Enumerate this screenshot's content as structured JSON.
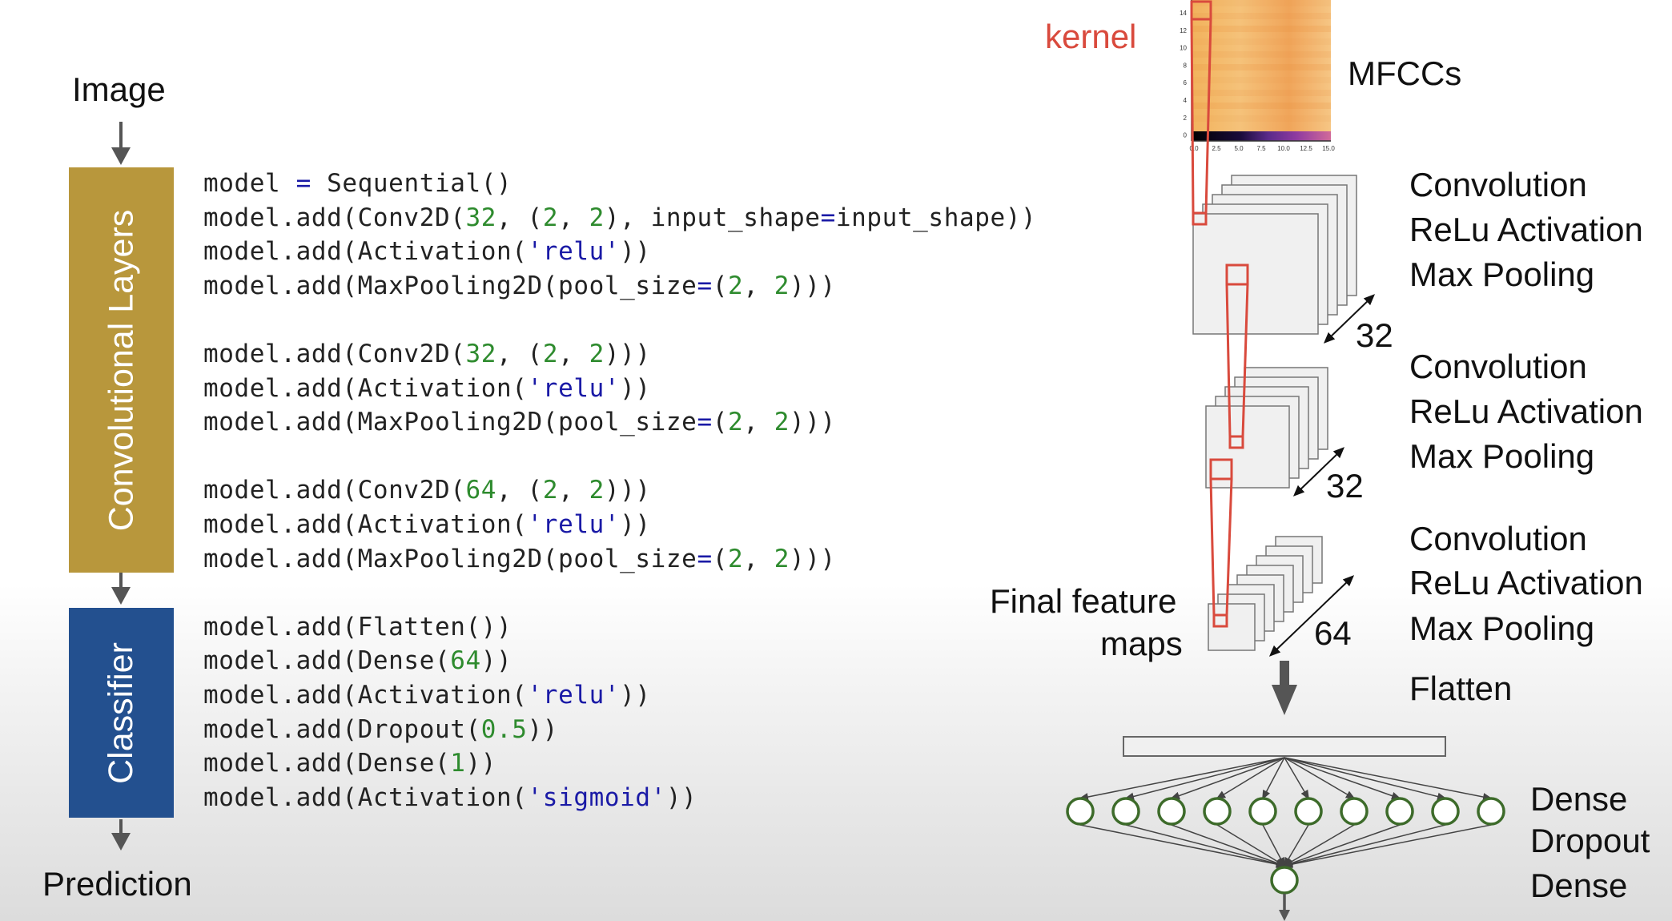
{
  "flow": {
    "input_label": "Image",
    "conv_block_label": "Convolutional Layers",
    "classifier_block_label": "Classifier",
    "output_label": "Prediction"
  },
  "code_lines": [
    [
      {
        "t": "model "
      },
      {
        "t": "=",
        "c": "op"
      },
      {
        "t": " Sequential()"
      }
    ],
    [
      {
        "t": "model.add(Conv2D("
      },
      {
        "t": "32",
        "c": "num"
      },
      {
        "t": ", ("
      },
      {
        "t": "2",
        "c": "num"
      },
      {
        "t": ", "
      },
      {
        "t": "2",
        "c": "num"
      },
      {
        "t": "), input_shape"
      },
      {
        "t": "=",
        "c": "op"
      },
      {
        "t": "input_shape))"
      }
    ],
    [
      {
        "t": "model.add(Activation("
      },
      {
        "t": "'relu'",
        "c": "str"
      },
      {
        "t": "))"
      }
    ],
    [
      {
        "t": "model.add(MaxPooling2D(pool_size"
      },
      {
        "t": "=",
        "c": "op"
      },
      {
        "t": "("
      },
      {
        "t": "2",
        "c": "num"
      },
      {
        "t": ", "
      },
      {
        "t": "2",
        "c": "num"
      },
      {
        "t": ")))"
      }
    ],
    [],
    [
      {
        "t": "model.add(Conv2D("
      },
      {
        "t": "32",
        "c": "num"
      },
      {
        "t": ", ("
      },
      {
        "t": "2",
        "c": "num"
      },
      {
        "t": ", "
      },
      {
        "t": "2",
        "c": "num"
      },
      {
        "t": ")))"
      }
    ],
    [
      {
        "t": "model.add(Activation("
      },
      {
        "t": "'relu'",
        "c": "str"
      },
      {
        "t": "))"
      }
    ],
    [
      {
        "t": "model.add(MaxPooling2D(pool_size"
      },
      {
        "t": "=",
        "c": "op"
      },
      {
        "t": "("
      },
      {
        "t": "2",
        "c": "num"
      },
      {
        "t": ", "
      },
      {
        "t": "2",
        "c": "num"
      },
      {
        "t": ")))"
      }
    ],
    [],
    [
      {
        "t": "model.add(Conv2D("
      },
      {
        "t": "64",
        "c": "num"
      },
      {
        "t": ", ("
      },
      {
        "t": "2",
        "c": "num"
      },
      {
        "t": ", "
      },
      {
        "t": "2",
        "c": "num"
      },
      {
        "t": ")))"
      }
    ],
    [
      {
        "t": "model.add(Activation("
      },
      {
        "t": "'relu'",
        "c": "str"
      },
      {
        "t": "))"
      }
    ],
    [
      {
        "t": "model.add(MaxPooling2D(pool_size"
      },
      {
        "t": "=",
        "c": "op"
      },
      {
        "t": "("
      },
      {
        "t": "2",
        "c": "num"
      },
      {
        "t": ", "
      },
      {
        "t": "2",
        "c": "num"
      },
      {
        "t": ")))"
      }
    ],
    [],
    [
      {
        "t": "model.add(Flatten())"
      }
    ],
    [
      {
        "t": "model.add(Dense("
      },
      {
        "t": "64",
        "c": "num"
      },
      {
        "t": "))"
      }
    ],
    [
      {
        "t": "model.add(Activation("
      },
      {
        "t": "'relu'",
        "c": "str"
      },
      {
        "t": "))"
      }
    ],
    [
      {
        "t": "model.add(Dropout("
      },
      {
        "t": "0.5",
        "c": "num"
      },
      {
        "t": "))"
      }
    ],
    [
      {
        "t": "model.add(Dense("
      },
      {
        "t": "1",
        "c": "num"
      },
      {
        "t": "))"
      }
    ],
    [
      {
        "t": "model.add(Activation("
      },
      {
        "t": "'sigmoid'",
        "c": "str"
      },
      {
        "t": "))"
      }
    ]
  ],
  "diagram": {
    "kernel_label": "kernel",
    "mfcc_label": "MFCCs",
    "mfcc_y_ticks": [
      "14",
      "12",
      "10",
      "8",
      "6",
      "4",
      "2",
      "0"
    ],
    "mfcc_x_ticks": [
      "0.0",
      "2.5",
      "5.0",
      "7.5",
      "10.0",
      "12.5",
      "15.0"
    ],
    "stages": [
      {
        "lines": [
          "Convolution",
          "ReLu Activation",
          "Max Pooling"
        ],
        "filters": "32"
      },
      {
        "lines": [
          "Convolution",
          "ReLu Activation",
          "Max Pooling"
        ],
        "filters": "32"
      },
      {
        "lines": [
          "Convolution",
          "ReLu Activation",
          "Max Pooling"
        ],
        "filters": "64"
      }
    ],
    "final_maps_label": [
      "Final feature",
      "maps"
    ],
    "flatten_label": "Flatten",
    "classifier_labels": [
      "Dense",
      "Dropout",
      "Dense"
    ],
    "dense_neuron_count": 10
  },
  "colors": {
    "conv_block": "#b8973c",
    "classifier_block": "#23508f",
    "kernel": "#d94a3d",
    "neuron": "#3d6b2a",
    "arrow": "#555555"
  }
}
